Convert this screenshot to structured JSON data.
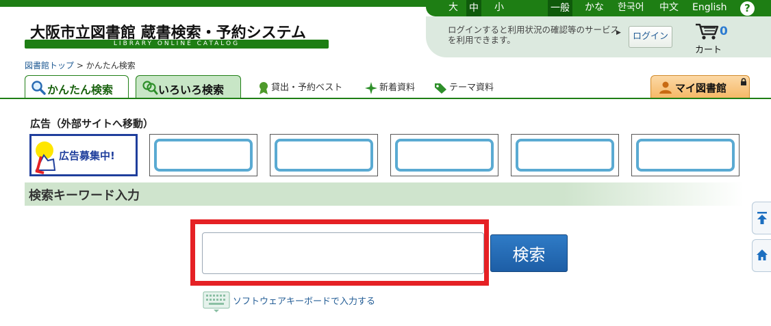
{
  "topbar": {
    "font_sizes": [
      "大",
      "中",
      "小"
    ],
    "selected_font_size": "中",
    "language_modes": [
      "一般",
      "かな",
      "한국어",
      "中文",
      "English"
    ],
    "selected_language_mode": "一般",
    "help_label": "?"
  },
  "login": {
    "message": "ログインすると利用状況の確認等のサービスを利用できます。",
    "button_label": "ログイン"
  },
  "cart": {
    "count": "0",
    "label": "カート"
  },
  "logo": {
    "title": "大阪市立図書館 蔵書検索・予約システム",
    "subtitle": "LIBRARY ONLINE CATALOG"
  },
  "breadcrumb": {
    "home_label": "図書館トップ",
    "separator": ">",
    "current": "かんたん検索"
  },
  "tabs": {
    "easy_search": "かんたん検索",
    "various_search": "いろいろ検索",
    "best_label": "貸出・予約ベスト",
    "new_label": "新着資料",
    "theme_label": "テーマ資料",
    "my_library": "マイ図書館"
  },
  "ads": {
    "title": "広告（外部サイトへ移動）",
    "recruit_text": "広告募集中!"
  },
  "search": {
    "section_title": "検索キーワード入力",
    "input_value": "",
    "button_label": "検索",
    "soft_keyboard_label": "ソフトウェアキーボードで入力する"
  },
  "colors": {
    "brand_green": "#1e7e14",
    "highlight_red": "#e52125",
    "search_button": "#1d5ea6"
  }
}
